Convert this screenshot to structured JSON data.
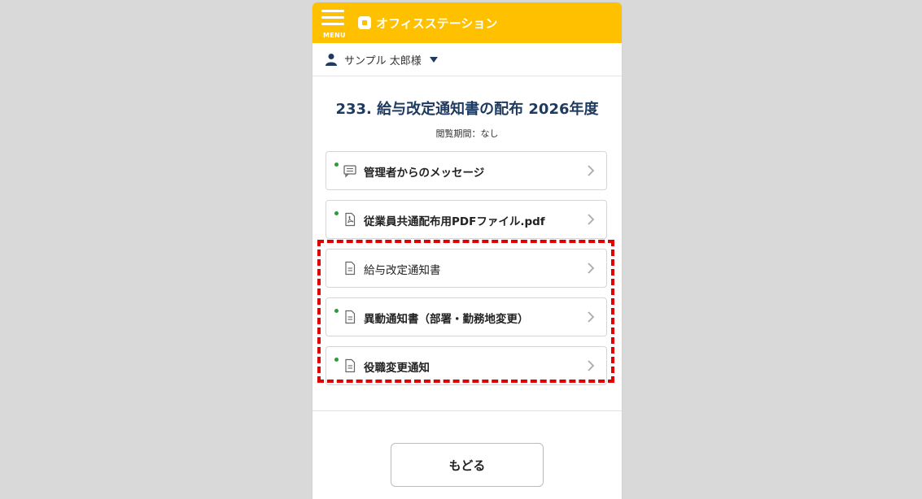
{
  "header": {
    "menu_label": "MENU",
    "logo_text": "オフィスステーション",
    "bar_color": "#ffc000"
  },
  "user": {
    "name": "サンプル 太郎様"
  },
  "page": {
    "title": "233. 給与改定通知書の配布 2026年度",
    "period": "閲覧期間：なし"
  },
  "items": [
    {
      "label": "管理者からのメッセージ",
      "icon": "message-icon",
      "unread": true
    },
    {
      "label": "従業員共通配布用PDFファイル.pdf",
      "icon": "pdf-icon",
      "unread": true
    },
    {
      "label": "給与改定通知書",
      "icon": "document-icon",
      "unread": false
    },
    {
      "label": "異動通知書（部署・勤務地変更）",
      "icon": "document-icon",
      "unread": true
    },
    {
      "label": "役職変更通知",
      "icon": "document-icon",
      "unread": true
    }
  ],
  "back_button": "もどる",
  "colors": {
    "accent": "#ffc000",
    "title": "#1f3a5f",
    "unread_dot": "#2e9a3e",
    "highlight": "#e00000"
  }
}
